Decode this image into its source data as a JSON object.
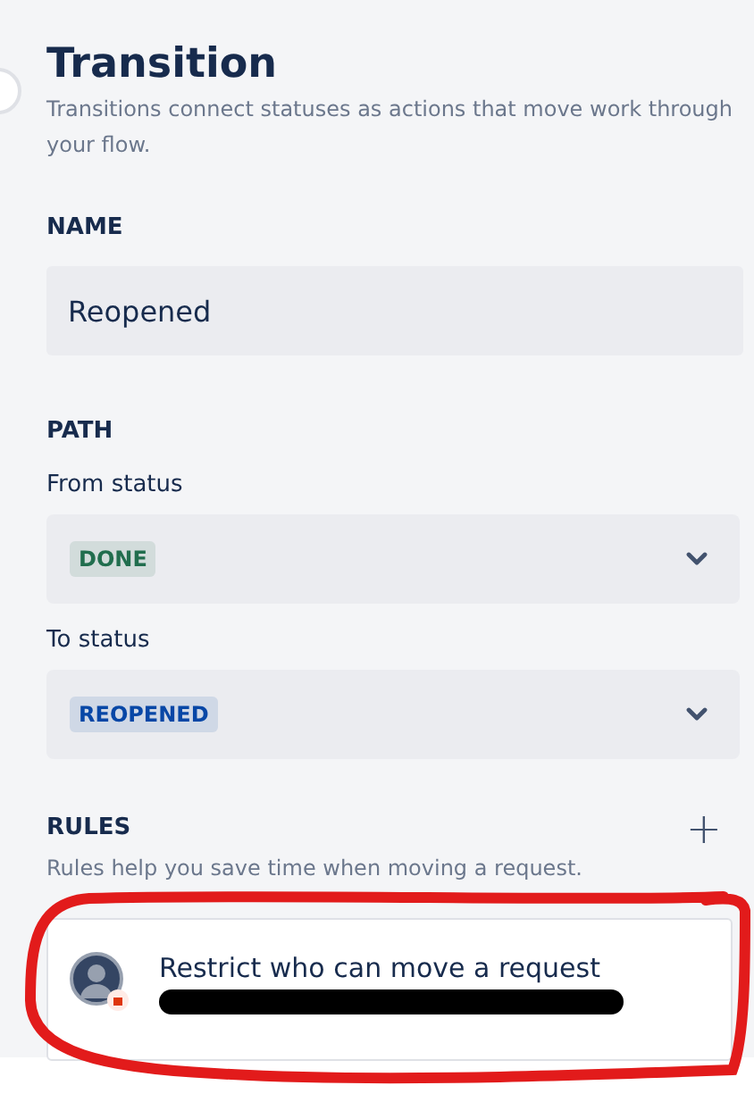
{
  "title": "Transition",
  "description": "Transitions connect statuses as actions that move work through your flow.",
  "name_section": {
    "label": "NAME",
    "value": "Reopened"
  },
  "path_section": {
    "label": "PATH",
    "fields": [
      {
        "label": "From status",
        "value": "DONE",
        "color": "#216e4e"
      },
      {
        "label": "To status",
        "value": "REOPENED",
        "color": "#0747a6"
      }
    ]
  },
  "rules_section": {
    "label": "RULES",
    "add": "+",
    "description": "Rules help you save time when moving a request.",
    "rules": [
      {
        "title": "Restrict who can move a request"
      }
    ]
  }
}
